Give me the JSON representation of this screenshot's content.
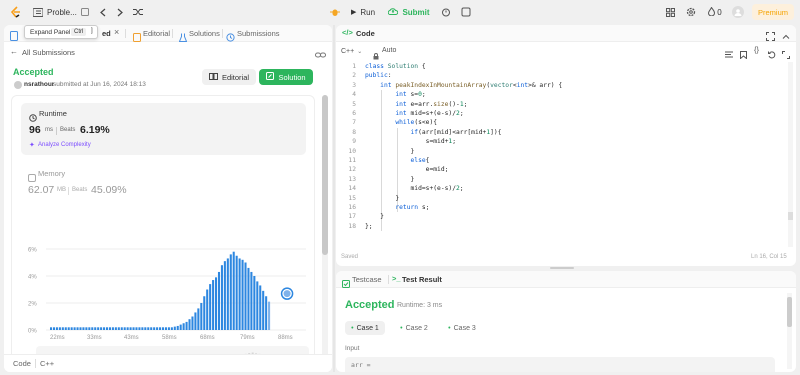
{
  "topbar": {
    "tab_title": "Proble...",
    "run_label": "Run",
    "submit_label": "Submit",
    "streak_count": "0",
    "premium_label": "Premium"
  },
  "tooltip": {
    "label": "Expand Panel",
    "shortcut": "Ctrl",
    "key": "]"
  },
  "left_tabs": {
    "current_suffix": "ed",
    "editorial": "Editorial",
    "solutions": "Solutions",
    "submissions": "Submissions"
  },
  "submission": {
    "back_label": "All Submissions",
    "status": "Accepted",
    "user": "nsrathour",
    "submitted_text": "submitted at Jun 16, 2024 18:13",
    "editorial_button": "Editorial",
    "solution_button": "Solution"
  },
  "runtime": {
    "title": "Runtime",
    "value": "96",
    "unit": "ms",
    "beats_label": "Beats",
    "beats_value": "6.19%",
    "analyze_label": "Analyze Complexity"
  },
  "memory": {
    "title": "Memory",
    "value": "62.07",
    "unit": "MB",
    "beats_label": "Beats",
    "beats_value": "45.09%"
  },
  "chart_data": {
    "type": "bar",
    "y_ticks": [
      "6%",
      "4%",
      "2%",
      "0%"
    ],
    "ylim": [
      0,
      6
    ],
    "x_ticks": [
      "22ms",
      "33ms",
      "43ms",
      "58ms",
      "68ms",
      "79ms",
      "88ms"
    ],
    "values": [
      0.2,
      0.2,
      0.2,
      0.2,
      0.2,
      0.2,
      0.2,
      0.2,
      0.2,
      0.2,
      0.2,
      0.2,
      0.2,
      0.2,
      0.2,
      0.2,
      0.2,
      0.2,
      0.2,
      0.2,
      0.2,
      0.2,
      0.2,
      0.2,
      0.2,
      0.2,
      0.2,
      0.2,
      0.2,
      0.2,
      0.2,
      0.2,
      0.2,
      0.2,
      0.2,
      0.2,
      0.2,
      0.2,
      0.2,
      0.2,
      0.2,
      0.2,
      0.25,
      0.3,
      0.4,
      0.5,
      0.6,
      0.8,
      1.0,
      1.3,
      1.6,
      2.0,
      2.5,
      3.0,
      3.4,
      3.7,
      3.9,
      4.3,
      4.8,
      5.1,
      5.3,
      5.6,
      5.8,
      5.5,
      5.3,
      5.2,
      5.0,
      4.6,
      4.3,
      4.0,
      3.6,
      3.3,
      2.9,
      2.5,
      2.1
    ],
    "highlight_index": 74,
    "bar_color": "#2d87e0",
    "highlight_color": "#7fb2ea"
  },
  "left_footer": {
    "label": "Code",
    "lang": "C++"
  },
  "code_panel": {
    "title": "Code",
    "lang": "C++",
    "mode": "Auto",
    "saved": "Saved",
    "cursor": "Ln 16, Col 15",
    "lines": [
      "class Solution {",
      "public:",
      "    int peakIndexInMountainArray(vector<int>& arr) {",
      "        int s=0;",
      "        int e=arr.size()-1;",
      "        int mid=s+(e-s)/2;",
      "        while(s<e){",
      "            if(arr[mid]<arr[mid+1]){",
      "                s=mid+1;",
      "            }",
      "            else{",
      "                e=mid;",
      "            }",
      "            mid=s+(e-s)/2;",
      "        }",
      "        return s;",
      "    }",
      "};"
    ]
  },
  "result_panel": {
    "testcase_tab": "Testcase",
    "result_tab": "Test Result",
    "status": "Accepted",
    "runtime_text": "Runtime: 3 ms",
    "cases": [
      "Case 1",
      "Case 2",
      "Case 3"
    ],
    "input_label": "Input",
    "input_value": "arr ="
  }
}
